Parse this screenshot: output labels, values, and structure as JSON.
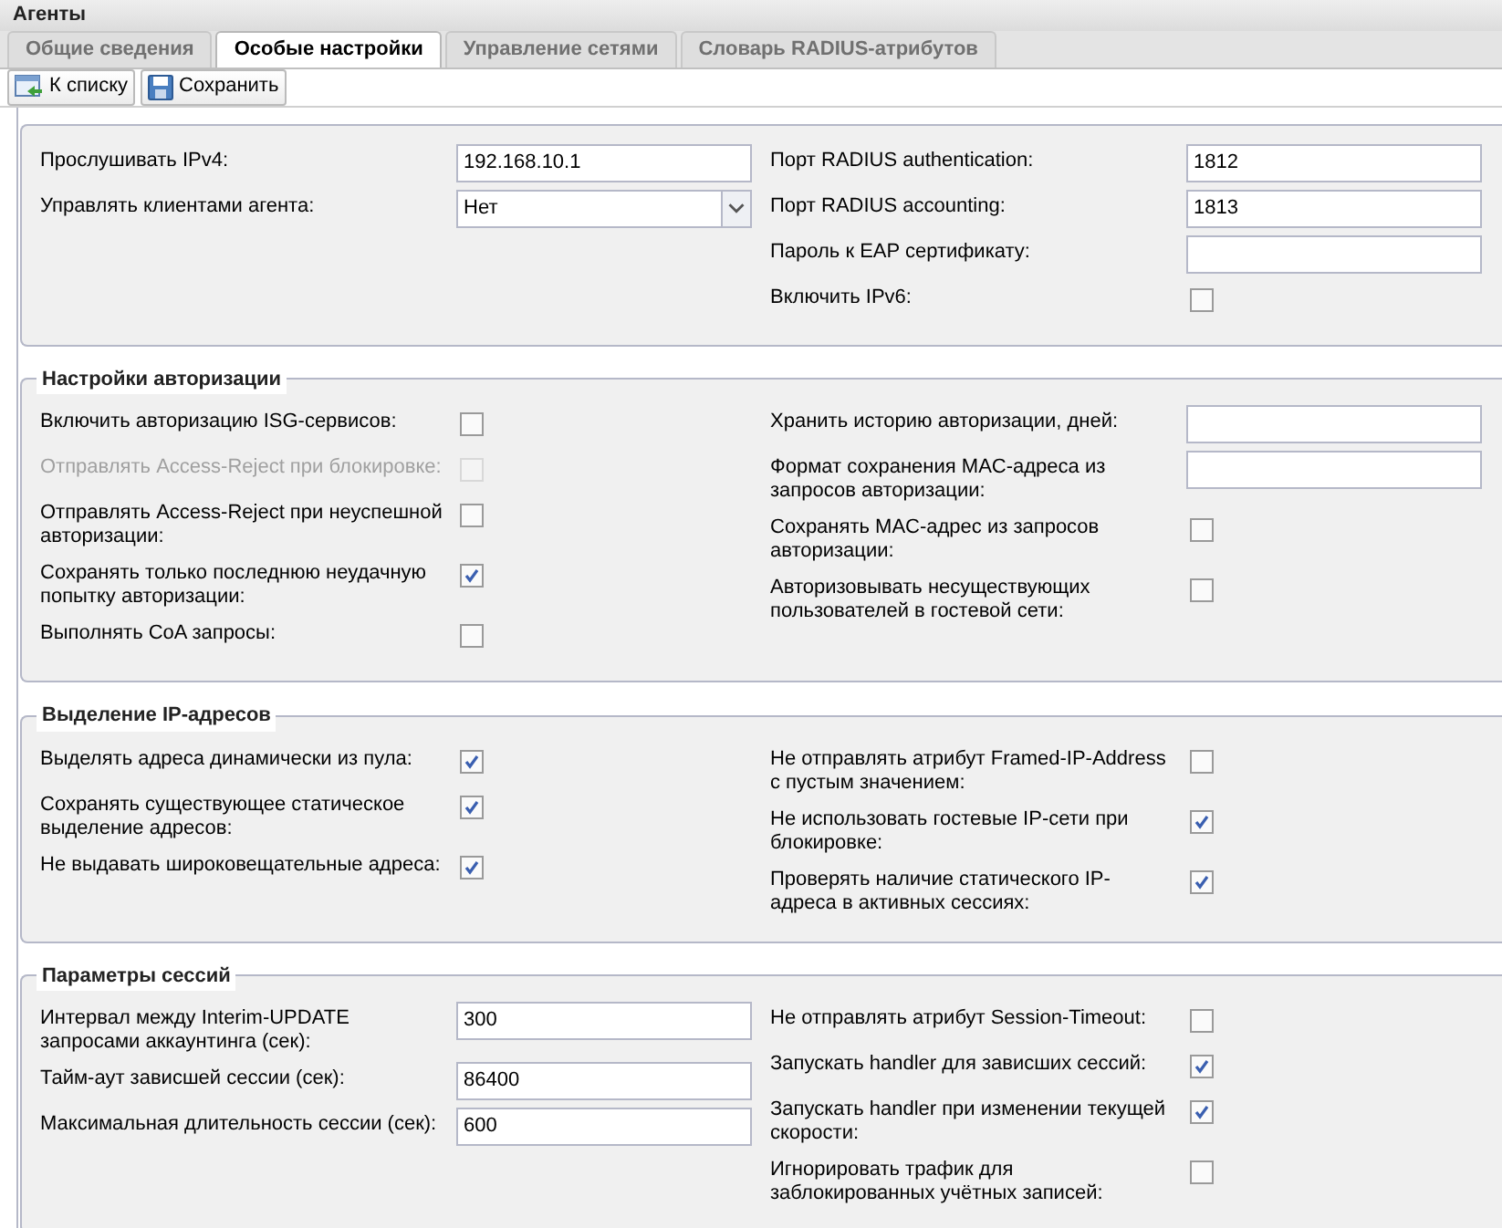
{
  "window": {
    "title": "Агенты"
  },
  "tabs": [
    {
      "label": "Общие сведения",
      "selected": false
    },
    {
      "label": "Особые настройки",
      "selected": true
    },
    {
      "label": "Управление сетями",
      "selected": false
    },
    {
      "label": "Словарь RADIUS-атрибутов",
      "selected": false
    }
  ],
  "toolbar": [
    {
      "label": "К списку",
      "kind": "back"
    },
    {
      "label": "Сохранить",
      "kind": "save"
    }
  ],
  "sections": [
    {
      "columns": [
        [
          {
            "label": "Прослушивать IPv4:",
            "kind": "text",
            "value": "192.168.10.1"
          },
          {
            "label": "Управлять клиентами агента:",
            "kind": "select",
            "value": "Нет"
          }
        ],
        [
          {
            "label": "Порт RADIUS authentication:",
            "kind": "text",
            "value": "1812"
          },
          {
            "label": "Порт RADIUS accounting:",
            "kind": "text",
            "value": "1813"
          },
          {
            "label": "Пароль к EAP сертификату:",
            "kind": "text"
          },
          {
            "label": "Включить IPv6:",
            "kind": "checkbox",
            "checked": false,
            "disabled": false
          }
        ]
      ]
    },
    {
      "legend": "Настройки авторизации",
      "columns": [
        [
          {
            "label": "Включить авторизацию ISG-сервисов:",
            "kind": "checkbox",
            "checked": false,
            "disabled": false
          },
          {
            "label": "Отправлять Access-Reject при блокировке:",
            "kind": "checkbox",
            "checked": false,
            "disabled": true
          },
          {
            "label": "Отправлять Access-Reject при неуспешной авторизации:",
            "kind": "checkbox",
            "checked": false,
            "disabled": false
          },
          {
            "label": "Сохранять только последнюю неудачную попытку авторизации:",
            "kind": "checkbox",
            "checked": true,
            "disabled": false
          },
          {
            "label": "Выполнять CoA запросы:",
            "kind": "checkbox",
            "checked": false,
            "disabled": false
          }
        ],
        [
          {
            "label": "Хранить историю авторизации, дней:",
            "kind": "text"
          },
          {
            "label": "Формат сохранения MAC-адреса из запросов авторизации:",
            "kind": "text"
          },
          {
            "label": "Сохранять MAC-адрес из запросов авторизации:",
            "kind": "checkbox",
            "checked": false,
            "disabled": false
          },
          {
            "label": "Авторизовывать несуществующих пользователей в гостевой сети:",
            "kind": "checkbox",
            "checked": false,
            "disabled": false
          }
        ]
      ]
    },
    {
      "legend": "Выделение IP-адресов",
      "columns": [
        [
          {
            "label": "Выделять адреса динамически из пула:",
            "kind": "checkbox",
            "checked": true,
            "disabled": false
          },
          {
            "label": "Сохранять существующее статическое выделение адресов:",
            "kind": "checkbox",
            "checked": true,
            "disabled": false
          },
          {
            "label": "Не выдавать широковещательные адреса:",
            "kind": "checkbox",
            "checked": true,
            "disabled": false
          }
        ],
        [
          {
            "label": "Не отправлять атрибут Framed-IP-Address с пустым значением:",
            "kind": "checkbox",
            "checked": false,
            "disabled": false
          },
          {
            "label": "Не использовать гостевые IP-сети при блокировке:",
            "kind": "checkbox",
            "checked": true,
            "disabled": false
          },
          {
            "label": "Проверять наличие статического IP-адреса в активных сессиях:",
            "kind": "checkbox",
            "checked": true,
            "disabled": false
          }
        ]
      ]
    },
    {
      "legend": "Параметры сессий",
      "columns": [
        [
          {
            "label": "Интервал между Interim-UPDATE запросами аккаунтинга (сек):",
            "kind": "text",
            "value": "300"
          },
          {
            "label": "Тайм-аут зависшей сессии (сек):",
            "kind": "text",
            "value": "86400"
          },
          {
            "label": "Максимальная длительность сессии (сек):",
            "kind": "text",
            "value": "600"
          }
        ],
        [
          {
            "label": "Не отправлять атрибут Session-Timeout:",
            "kind": "checkbox",
            "checked": false,
            "disabled": false
          },
          {
            "label": "Запускать handler для зависших сессий:",
            "kind": "checkbox",
            "checked": true,
            "disabled": false
          },
          {
            "label": "Запускать handler при изменении текущей скорости:",
            "kind": "checkbox",
            "checked": true,
            "disabled": false
          },
          {
            "label": "Игнорировать трафик для заблокированных учётных записей:",
            "kind": "checkbox",
            "checked": false,
            "disabled": false
          }
        ]
      ]
    }
  ]
}
